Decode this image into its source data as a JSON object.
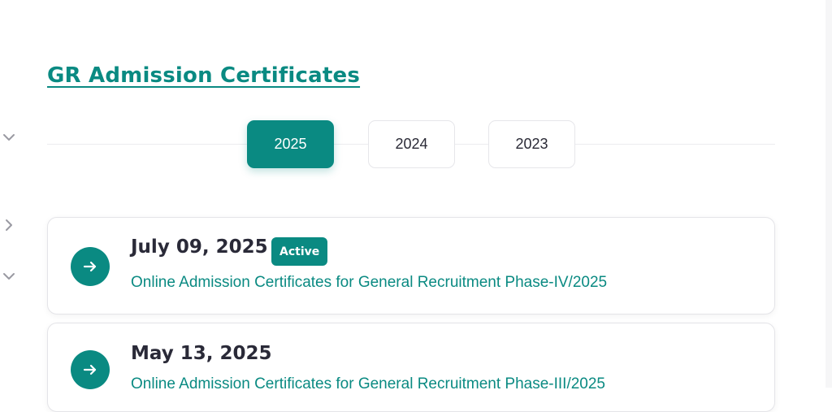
{
  "page": {
    "title": "GR Admission Certificates"
  },
  "year_tabs": [
    {
      "label": "2025",
      "active": true
    },
    {
      "label": "2024",
      "active": false
    },
    {
      "label": "2023",
      "active": false
    }
  ],
  "entries": [
    {
      "date": "July 09, 2025",
      "badge": "Active",
      "link": "Online Admission Certificates for General Recruitment Phase-IV/2025"
    },
    {
      "date": "May 13, 2025",
      "badge": "",
      "link": "Online Admission Certificates for General Recruitment Phase-III/2025"
    }
  ],
  "sidebar_toggles": [
    {
      "icon": "chevron-down-icon"
    },
    {
      "icon": "chevron-right-icon"
    },
    {
      "icon": "chevron-down-icon"
    }
  ],
  "colors": {
    "accent": "#0a8a82",
    "text_dark": "#2a2a38",
    "border": "#e4e4e8"
  }
}
